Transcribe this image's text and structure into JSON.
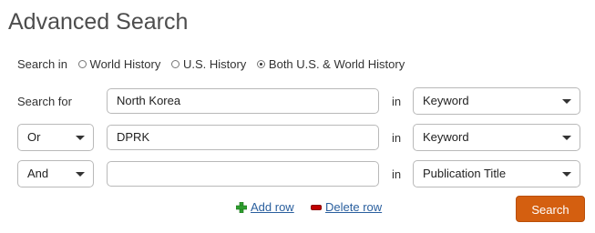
{
  "title": "Advanced Search",
  "search_in": {
    "label": "Search in",
    "options": [
      {
        "label": "World History",
        "checked": false
      },
      {
        "label": "U.S. History",
        "checked": false
      },
      {
        "label": "Both U.S. & World History",
        "checked": true
      }
    ]
  },
  "rows": [
    {
      "operator_label": "Search for",
      "value": "North Korea",
      "in_label": "in",
      "field": "Keyword"
    },
    {
      "operator": "Or",
      "value": "DPRK",
      "in_label": "in",
      "field": "Keyword"
    },
    {
      "operator": "And",
      "value": "",
      "in_label": "in",
      "field": "Publication Title"
    }
  ],
  "actions": {
    "add_row": "Add row",
    "delete_row": "Delete row",
    "search": "Search"
  },
  "colors": {
    "accent": "#d45f10",
    "link": "#2a5f9e"
  }
}
